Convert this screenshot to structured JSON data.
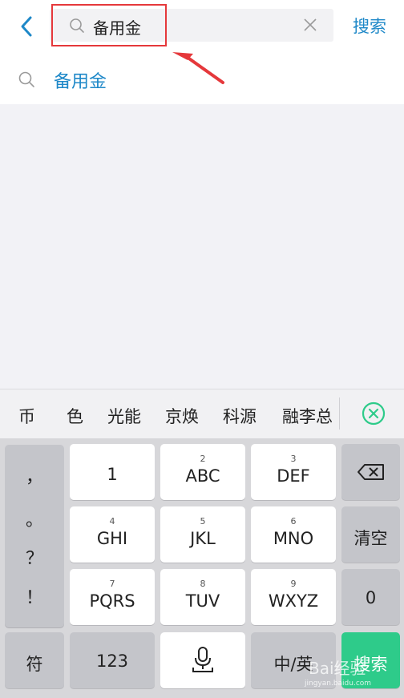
{
  "search": {
    "value": "备用金",
    "button_label": "搜索"
  },
  "suggestions": [
    {
      "label": "备用金"
    }
  ],
  "candidates": [
    "币",
    "色",
    "光能",
    "京焕",
    "科源",
    "融李总"
  ],
  "keyboard": {
    "punctuation": [
      "，",
      "。",
      "？",
      "！"
    ],
    "rows": [
      [
        {
          "main": "1",
          "sub": ""
        },
        {
          "main": "ABC",
          "sub": "2"
        },
        {
          "main": "DEF",
          "sub": "3"
        }
      ],
      [
        {
          "main": "GHI",
          "sub": "4"
        },
        {
          "main": "JKL",
          "sub": "5"
        },
        {
          "main": "MNO",
          "sub": "6"
        }
      ],
      [
        {
          "main": "PQRS",
          "sub": "7"
        },
        {
          "main": "TUV",
          "sub": "8"
        },
        {
          "main": "WXYZ",
          "sub": "9"
        }
      ]
    ],
    "clear_label": "清空",
    "zero_label": "0",
    "symbol_label": "符",
    "num_label": "123",
    "lang_label": "中/英",
    "enter_label": "搜索"
  },
  "watermark": {
    "text": "Bai经验",
    "url": "jingyan.baidu.com"
  },
  "colors": {
    "accent": "#1e88c8",
    "annotation": "#e5383b",
    "enter": "#2ecb8a"
  }
}
